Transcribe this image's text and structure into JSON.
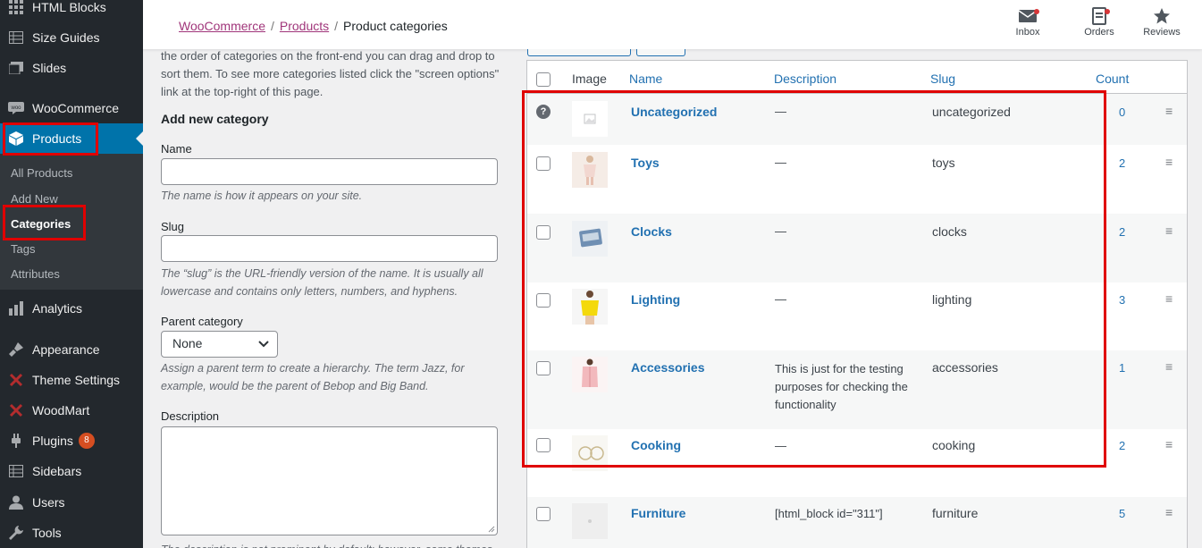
{
  "sidebar": {
    "items": [
      {
        "label": "HTML Blocks",
        "icon": "grid-icon"
      },
      {
        "label": "Size Guides",
        "icon": "table-icon"
      },
      {
        "label": "Slides",
        "icon": "slides-icon"
      },
      {
        "label": "WooCommerce",
        "icon": "woo-icon"
      },
      {
        "label": "Products",
        "icon": "box-icon"
      },
      {
        "label": "Analytics",
        "icon": "bar-chart-icon"
      },
      {
        "label": "Appearance",
        "icon": "brush-icon"
      },
      {
        "label": "Theme Settings",
        "icon": "x-icon"
      },
      {
        "label": "WoodMart",
        "icon": "x-icon"
      },
      {
        "label": "Plugins",
        "icon": "plug-icon",
        "badge": "8"
      },
      {
        "label": "Sidebars",
        "icon": "table-icon"
      },
      {
        "label": "Users",
        "icon": "user-icon"
      },
      {
        "label": "Tools",
        "icon": "wrench-icon"
      }
    ],
    "submenu": [
      "All Products",
      "Add New",
      "Categories",
      "Tags",
      "Attributes"
    ]
  },
  "breadcrumb": {
    "woocommerce": "WooCommerce",
    "products": "Products",
    "current": "Product categories",
    "sep": "/"
  },
  "topbar": {
    "inbox": "Inbox",
    "orders": "Orders",
    "reviews": "Reviews"
  },
  "form": {
    "intro_line1": "the order of categories on the front-end you can drag and drop to",
    "intro_line2": "sort them. To see more categories listed click the \"screen options\"",
    "intro_line3": "link at the top-right of this page.",
    "heading": "Add new category",
    "name_label": "Name",
    "name_help": "The name is how it appears on your site.",
    "slug_label": "Slug",
    "slug_help_1": "The “slug” is the URL-friendly version of the name. It is usually all",
    "slug_help_2": "lowercase and contains only letters, numbers, and hyphens.",
    "parent_label": "Parent category",
    "parent_value": "None",
    "parent_help_1": "Assign a parent term to create a hierarchy. The term Jazz, for",
    "parent_help_2": "example, would be the parent of Bebop and Big Band.",
    "desc_label": "Description",
    "desc_help_partial": "The description is not prominent by default; however, some themes"
  },
  "table": {
    "headers": {
      "image": "Image",
      "name": "Name",
      "description": "Description",
      "slug": "Slug",
      "count": "Count"
    },
    "rows": [
      {
        "name": "Uncategorized",
        "desc": "—",
        "slug": "uncategorized",
        "count": "0"
      },
      {
        "name": "Toys",
        "desc": "—",
        "slug": "toys",
        "count": "2"
      },
      {
        "name": "Clocks",
        "desc": "—",
        "slug": "clocks",
        "count": "2"
      },
      {
        "name": "Lighting",
        "desc": "—",
        "slug": "lighting",
        "count": "3"
      },
      {
        "name": "Accessories",
        "desc": "This is just for the testing purposes for checking the functionality",
        "slug": "accessories",
        "count": "1"
      },
      {
        "name": "Cooking",
        "desc": "—",
        "slug": "cooking",
        "count": "2"
      },
      {
        "name": "Furniture",
        "desc": "[html_block id=\"311\"]",
        "slug": "furniture",
        "count": "5"
      }
    ]
  },
  "colors": {
    "sidebar_bg": "#23282d",
    "active": "#0073aa",
    "link": "#2271b1",
    "highlight_box": "#e00000"
  }
}
